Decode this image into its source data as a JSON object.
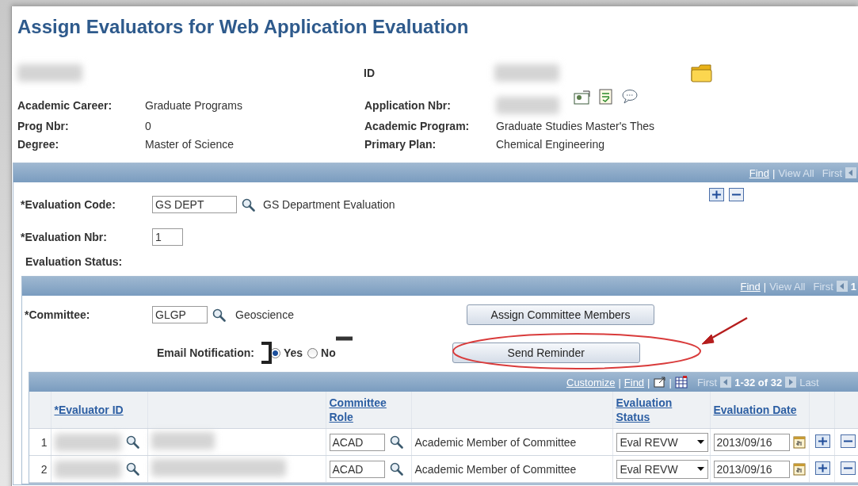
{
  "title": "Assign Evaluators for Web Application Evaluation",
  "id_label": "ID",
  "info_rows": [
    {
      "left": {
        "label": "Academic Career:",
        "value": "Graduate Programs"
      },
      "right": {
        "label": "Application Nbr:"
      }
    },
    {
      "left": {
        "label": "Prog Nbr:",
        "value": "0"
      },
      "right": {
        "label": "Academic Program:",
        "value": "Graduate Studies Master's Thes"
      }
    },
    {
      "left": {
        "label": "Degree:",
        "value": "Master of Science"
      },
      "right": {
        "label": "Primary Plan:",
        "value": "Chemical Engineering"
      }
    }
  ],
  "evaluation_panel": {
    "nav": {
      "find": "Find",
      "separator": "|",
      "view_all": "View All",
      "first": "First"
    },
    "code": {
      "label": "*Evaluation Code:",
      "value": "GS DEPT",
      "description": "GS Department Evaluation"
    },
    "nbr": {
      "label": "*Evaluation Nbr:",
      "value": "1"
    },
    "status_label": "Evaluation Status:"
  },
  "committee_panel": {
    "nav": {
      "find": "Find",
      "separator": "|",
      "view_all": "View All",
      "first": "First",
      "page": "1"
    },
    "committee": {
      "label": "*Committee:",
      "value": "GLGP",
      "description": "Geoscience"
    },
    "buttons": [
      "Assign Committee Members",
      "Send Reminder"
    ],
    "email": {
      "label": "Email Notification:",
      "options": [
        {
          "label": "Yes",
          "selected": true
        },
        {
          "label": "No",
          "selected": false
        }
      ]
    }
  },
  "grid": {
    "nav": {
      "customize": "Customize",
      "separators": [
        "|",
        "|",
        "|"
      ],
      "find": "Find",
      "first": "First",
      "range": "1-32 of 32",
      "last": "Last"
    },
    "columns": [
      "*Evaluator ID",
      "Committee Role",
      "Evaluation Status",
      "Evaluation Date"
    ],
    "rows": [
      {
        "num": "1",
        "role": "ACAD",
        "role_desc": "Academic Member of Committee",
        "status": "Eval REVW",
        "date": "2013/09/16"
      },
      {
        "num": "2",
        "role": "ACAD",
        "role_desc": "Academic Member of Committee",
        "status": "Eval REVW",
        "date": "2013/09/16"
      }
    ]
  }
}
